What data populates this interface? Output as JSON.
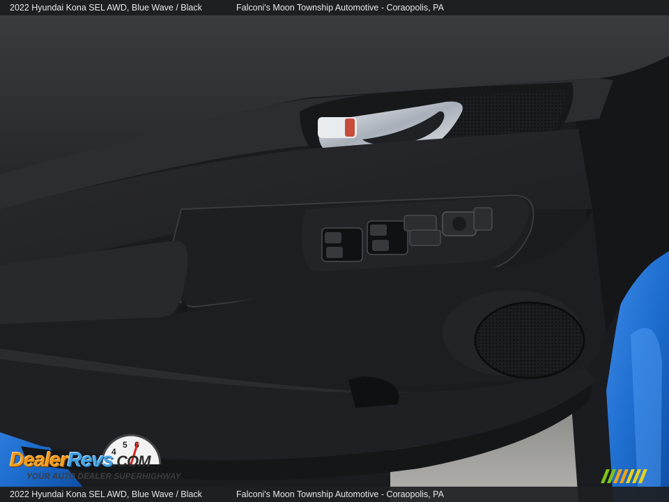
{
  "caption": {
    "vehicle": "2022 Hyundai Kona SEL AWD,  Blue Wave / Black",
    "dealer": "Falconi's Moon Township Automotive - Coraopolis, PA"
  },
  "watermark": {
    "brand": "DealerRevs.com",
    "tagline": "YOUR AUTO DEALER SUPERHIGHWAY"
  },
  "colors": {
    "body_paint": "#1f6fd0",
    "interior": "#222326",
    "trim": "#2e2f33",
    "chrome": "#c9ced6"
  }
}
